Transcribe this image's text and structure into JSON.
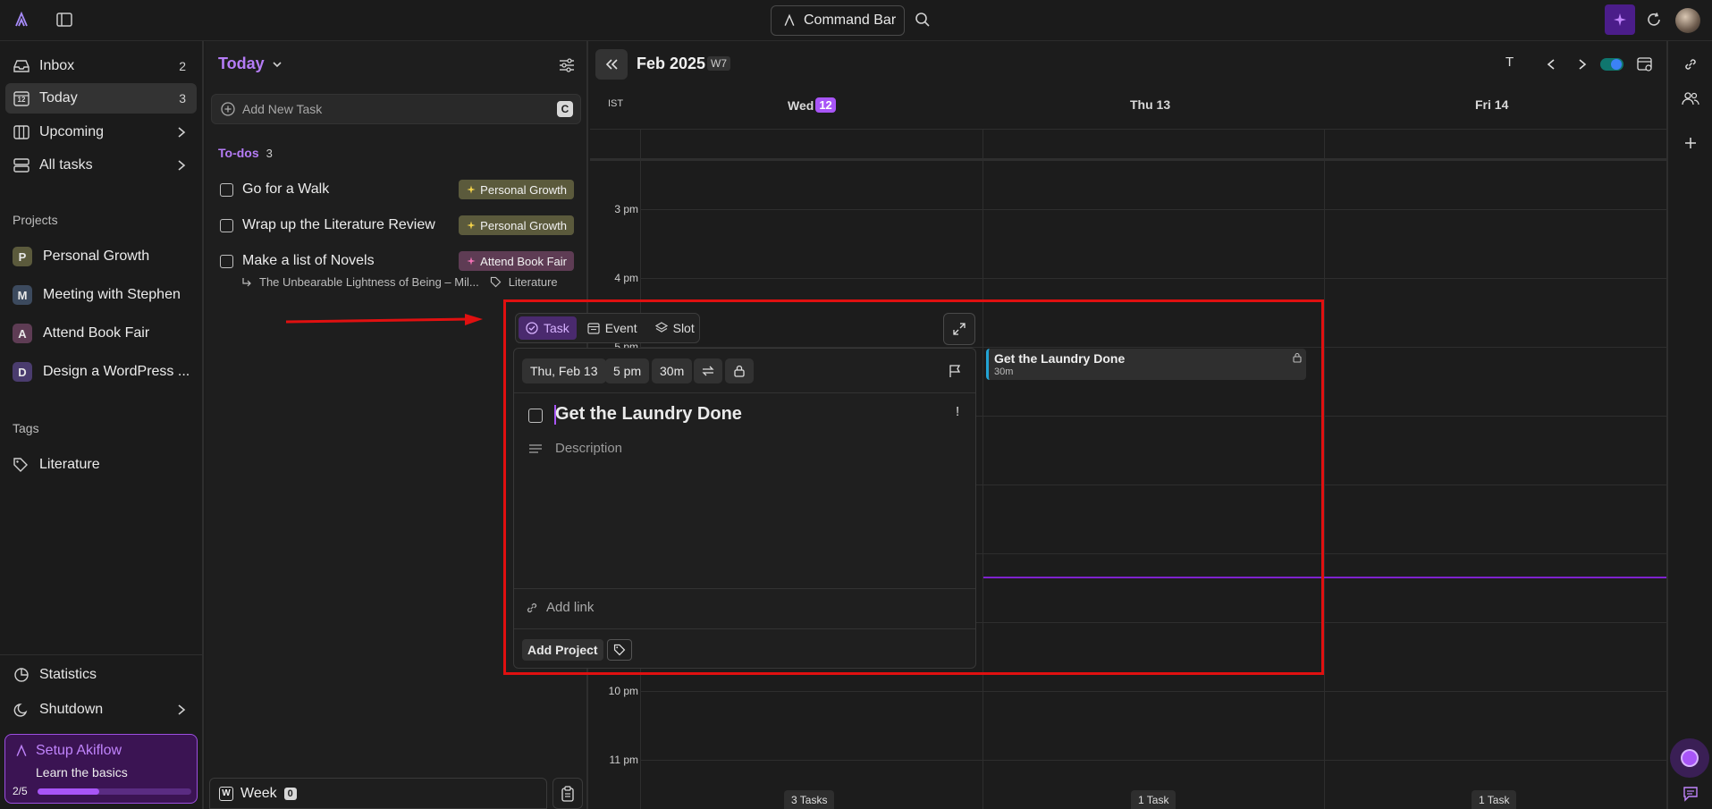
{
  "topbar": {
    "command_bar_label": "Command Bar"
  },
  "sidebar": {
    "nav": [
      {
        "label": "Inbox",
        "count": "2"
      },
      {
        "label": "Today",
        "count": "3",
        "day_number": "12"
      },
      {
        "label": "Upcoming"
      },
      {
        "label": "All tasks"
      }
    ],
    "projects_title": "Projects",
    "projects": [
      {
        "initial": "P",
        "label": "Personal Growth",
        "color": "#5b5a3c"
      },
      {
        "initial": "M",
        "label": "Meeting with Stephen",
        "color": "#3c4a5e"
      },
      {
        "initial": "A",
        "label": "Attend Book Fair",
        "color": "#5e3c54"
      },
      {
        "initial": "D",
        "label": "Design a WordPress ...",
        "color": "#4a3c6e"
      }
    ],
    "tags_title": "Tags",
    "tags": [
      {
        "label": "Literature"
      }
    ],
    "bottom": [
      {
        "label": "Statistics"
      },
      {
        "label": "Shutdown"
      }
    ],
    "setup": {
      "title": "Setup Akiflow",
      "subtitle": "Learn the basics",
      "progress_text": "2/5",
      "progress": 0.4
    }
  },
  "tasks": {
    "title": "Today",
    "add_placeholder": "Add New Task",
    "add_shortcut": "C",
    "todos_title": "To-dos",
    "todos_count": "3",
    "items": [
      {
        "label": "Go for a Walk",
        "tag": "Personal Growth",
        "tag_color": "#5b5a3c"
      },
      {
        "label": "Wrap up the Literature Review",
        "tag": "Personal Growth",
        "tag_color": "#5b5a3c"
      },
      {
        "label": "Make a list of Novels",
        "tag": "Attend Book Fair",
        "tag_color": "#5e3c54",
        "subtitle": "The Unbearable Lightness of Being – Mil...",
        "subtag": "Literature"
      }
    ],
    "footer": {
      "week_label": "Week",
      "week_count": "0",
      "week_key": "W"
    }
  },
  "calendar": {
    "month": "Feb 2025",
    "week": "W7",
    "timezone": "IST",
    "today_key": "T",
    "days": [
      {
        "name": "Wed",
        "num": "12",
        "count": "3 Tasks"
      },
      {
        "name": "Thu",
        "num": "13",
        "count": "1 Task"
      },
      {
        "name": "Fri",
        "num": "14",
        "count": "1 Task"
      }
    ],
    "hours": [
      "3 pm",
      "4 pm",
      "5 pm",
      "10 pm",
      "11 pm"
    ],
    "event": {
      "title": "Get the Laundry Done",
      "duration": "30m"
    }
  },
  "popover": {
    "modes": [
      "Task",
      "Event",
      "Slot"
    ],
    "date": "Thu, Feb 13",
    "time": "5 pm",
    "duration": "30m",
    "title": "Get the Laundry Done",
    "priority": "!",
    "description_placeholder": "Description",
    "add_link": "Add link",
    "add_project": "Add Project"
  },
  "colors": {
    "accent": "#a855f7",
    "highlight": "#e01010"
  }
}
